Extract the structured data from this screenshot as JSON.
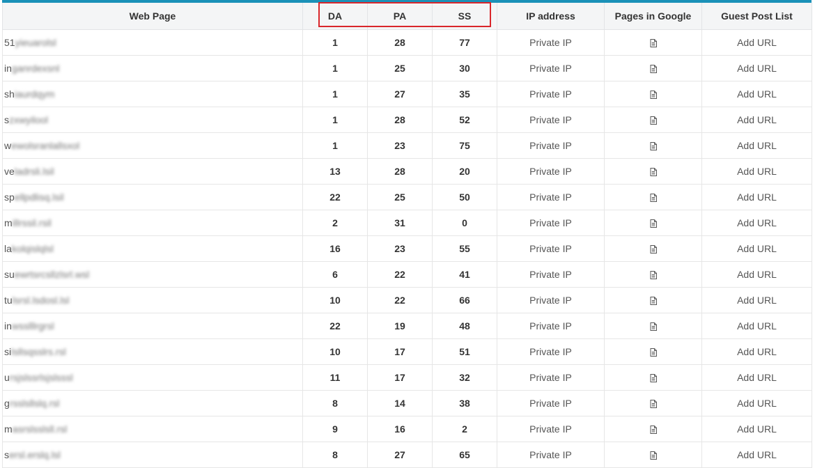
{
  "columns": {
    "web_page": "Web Page",
    "da": "DA",
    "pa": "PA",
    "ss": "SS",
    "ip": "IP address",
    "pages_google": "Pages in Google",
    "guest_post": "Guest Post List"
  },
  "highlight_color": "#d9262b",
  "accent_color": "#1a91b8",
  "row_icon": "document-icon",
  "rows": [
    {
      "site_prefix": "51",
      "site_blur": "yieuarolsl",
      "da": "1",
      "pa": "28",
      "ss": "77",
      "ip": "Private IP",
      "action": "Add URL"
    },
    {
      "site_prefix": "in",
      "site_blur": "ganrdexsnl",
      "da": "1",
      "pa": "25",
      "ss": "30",
      "ip": "Private IP",
      "action": "Add URL"
    },
    {
      "site_prefix": "sh",
      "site_blur": "iaurdqym",
      "da": "1",
      "pa": "27",
      "ss": "35",
      "ip": "Private IP",
      "action": "Add URL"
    },
    {
      "site_prefix": "s",
      "site_blur": "zxwyilool",
      "da": "1",
      "pa": "28",
      "ss": "52",
      "ip": "Private IP",
      "action": "Add URL"
    },
    {
      "site_prefix": "w",
      "site_blur": "ewolsranlallsxol",
      "da": "1",
      "pa": "23",
      "ss": "75",
      "ip": "Private IP",
      "action": "Add URL"
    },
    {
      "site_prefix": "ve",
      "site_blur": "ladrsli.lsil",
      "da": "13",
      "pa": "28",
      "ss": "20",
      "ip": "Private IP",
      "action": "Add URL"
    },
    {
      "site_prefix": "sp",
      "site_blur": "ellpdlisq.lsil",
      "da": "22",
      "pa": "25",
      "ss": "50",
      "ip": "Private IP",
      "action": "Add URL"
    },
    {
      "site_prefix": "m",
      "site_blur": "illrssil.rsil",
      "da": "2",
      "pa": "31",
      "ss": "0",
      "ip": "Private IP",
      "action": "Add URL"
    },
    {
      "site_prefix": "la",
      "site_blur": "kolqislqlsl",
      "da": "16",
      "pa": "23",
      "ss": "55",
      "ip": "Private IP",
      "action": "Add URL"
    },
    {
      "site_prefix": "su",
      "site_blur": "ewrtsrcsllzlsrl.wsl",
      "da": "6",
      "pa": "22",
      "ss": "41",
      "ip": "Private IP",
      "action": "Add URL"
    },
    {
      "site_prefix": "tu",
      "site_blur": "lsrsl.lsdosl.lsl",
      "da": "10",
      "pa": "22",
      "ss": "66",
      "ip": "Private IP",
      "action": "Add URL"
    },
    {
      "site_prefix": "in",
      "site_blur": "wsslllrgrsl",
      "da": "22",
      "pa": "19",
      "ss": "48",
      "ip": "Private IP",
      "action": "Add URL"
    },
    {
      "site_prefix": "si",
      "site_blur": "lsllsqsslrs.rsl",
      "da": "10",
      "pa": "17",
      "ss": "51",
      "ip": "Private IP",
      "action": "Add URL"
    },
    {
      "site_prefix": "u",
      "site_blur": "rsjslssrlsjslsssl",
      "da": "11",
      "pa": "17",
      "ss": "32",
      "ip": "Private IP",
      "action": "Add URL"
    },
    {
      "site_prefix": "g",
      "site_blur": "rsslsllslq.rsl",
      "da": "8",
      "pa": "14",
      "ss": "38",
      "ip": "Private IP",
      "action": "Add URL"
    },
    {
      "site_prefix": "m",
      "site_blur": "asrslsslsll.rsl",
      "da": "9",
      "pa": "16",
      "ss": "2",
      "ip": "Private IP",
      "action": "Add URL"
    },
    {
      "site_prefix": "s",
      "site_blur": "ersl.erslq.lsl",
      "da": "8",
      "pa": "27",
      "ss": "65",
      "ip": "Private IP",
      "action": "Add URL"
    }
  ]
}
